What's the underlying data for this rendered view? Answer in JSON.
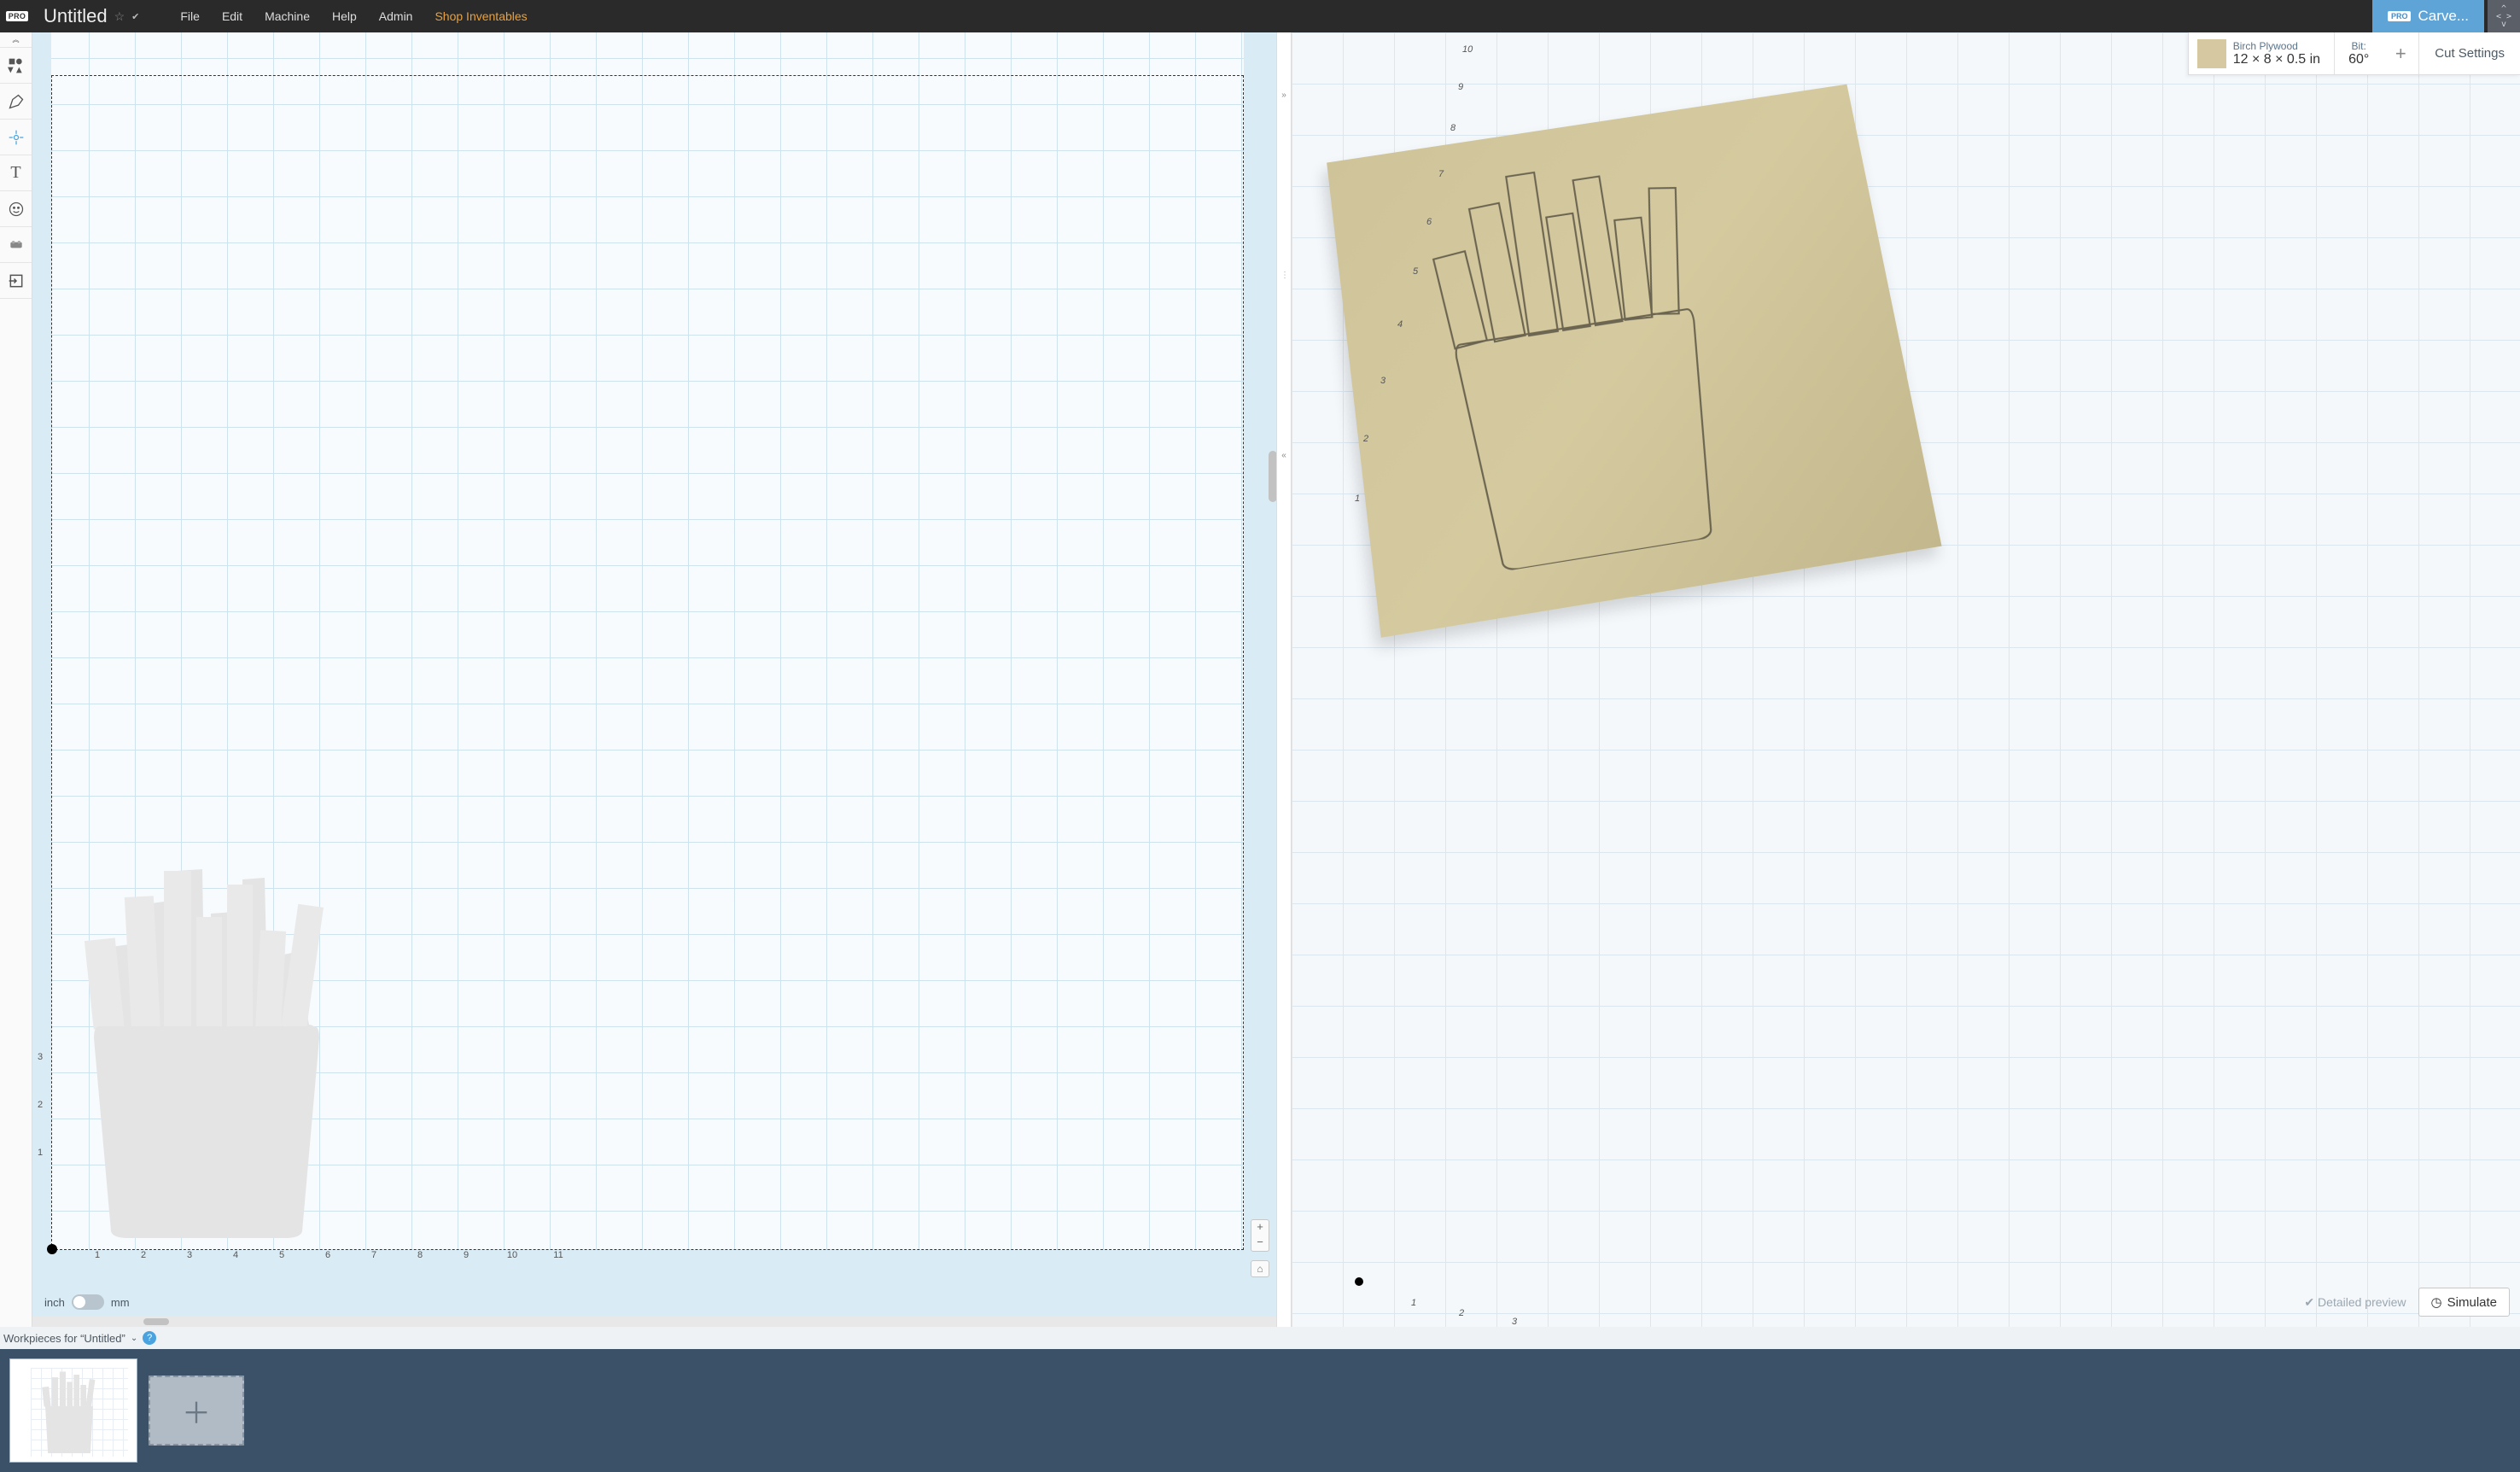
{
  "header": {
    "pro_badge": "PRO",
    "title": "Untitled",
    "menu": {
      "file": "File",
      "edit": "Edit",
      "machine": "Machine",
      "help": "Help",
      "admin": "Admin",
      "shop": "Shop Inventables"
    },
    "carve": {
      "badge": "PRO",
      "label": "Carve..."
    }
  },
  "canvas": {
    "x_ticks": [
      "1",
      "2",
      "3",
      "4",
      "5",
      "6",
      "7",
      "8",
      "9",
      "10",
      "11"
    ],
    "y_ticks": [
      "1",
      "2",
      "3"
    ],
    "units": {
      "inch": "inch",
      "mm": "mm"
    }
  },
  "material": {
    "name": "Birch Plywood",
    "dimensions": "12 × 8 × 0.5 in",
    "bit_label": "Bit:",
    "bit_value": "60°",
    "cut_settings": "Cut Settings"
  },
  "preview3d": {
    "axis_nums": [
      "1",
      "2",
      "3",
      "4",
      "5",
      "6",
      "7",
      "8",
      "9",
      "10"
    ],
    "bottom_nums": [
      "1",
      "2",
      "3"
    ],
    "detailed": "Detailed preview",
    "simulate": "Simulate"
  },
  "workpieces": {
    "header": "Workpieces for “Untitled”"
  }
}
